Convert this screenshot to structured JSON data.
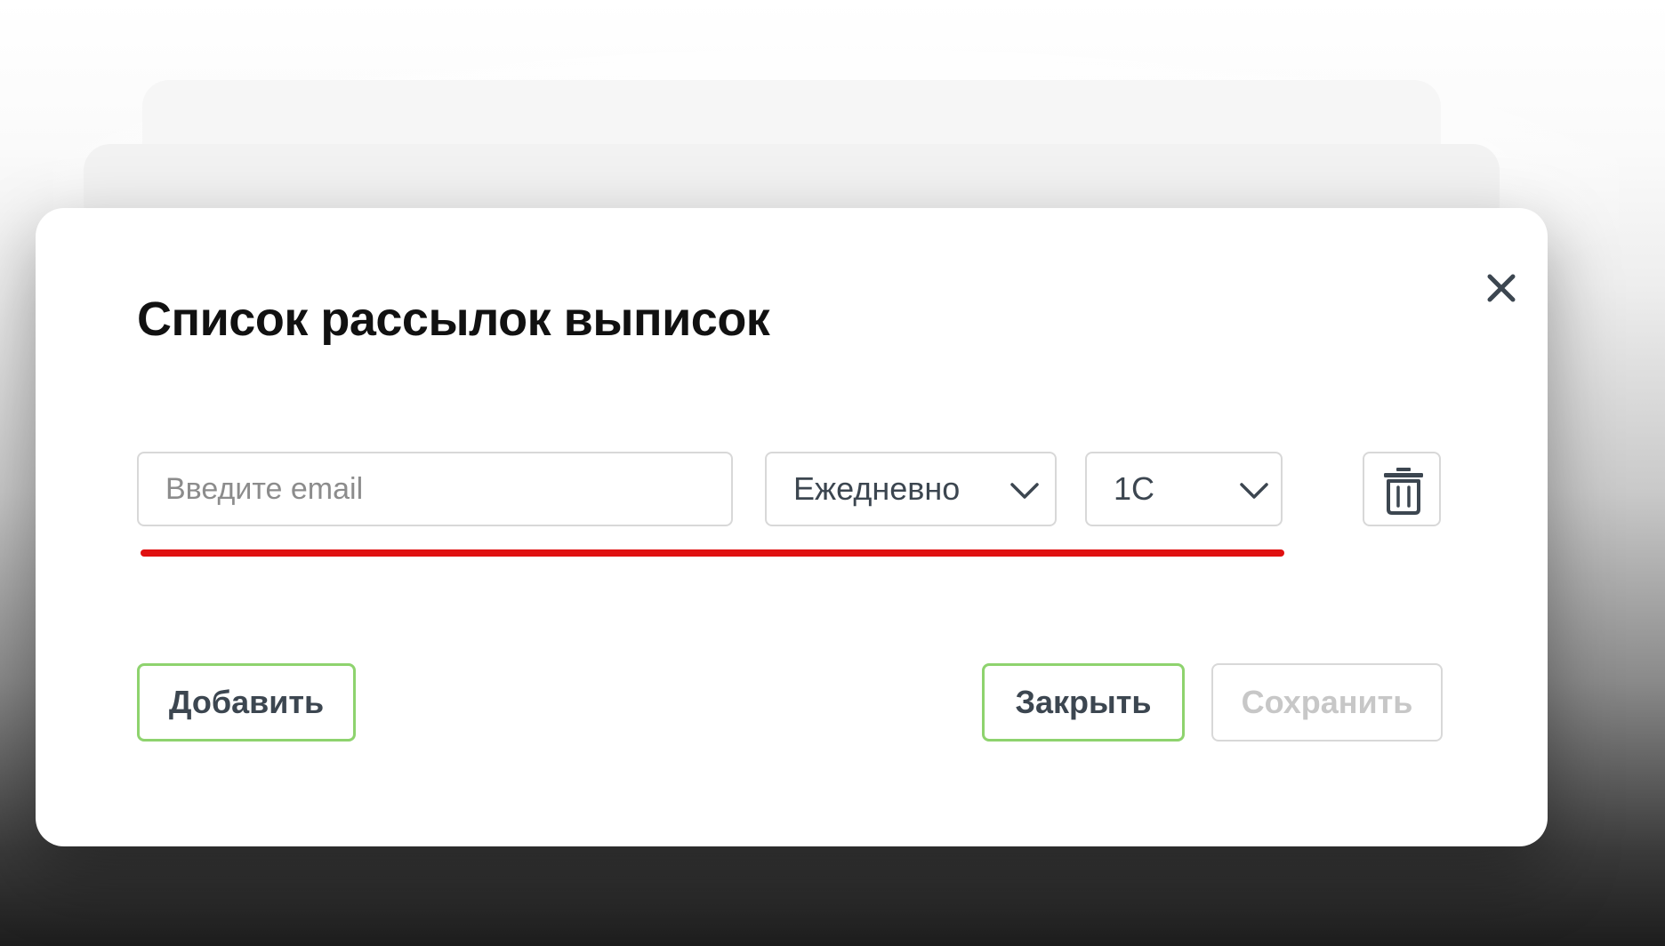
{
  "dialog": {
    "title": "Список рассылок выписок",
    "close_icon": "close-icon"
  },
  "form": {
    "email": {
      "value": "",
      "placeholder": "Введите email"
    },
    "frequency": {
      "selected": "Ежедневно",
      "icon": "chevron-down-icon"
    },
    "format": {
      "selected": "1С",
      "icon": "chevron-down-icon"
    },
    "delete_icon": "trash-icon"
  },
  "actions": {
    "add_label": "Добавить",
    "close_label": "Закрыть",
    "save_label": "Сохранить"
  },
  "colors": {
    "annotation_underline": "#e01010",
    "accent_border": "#8ed36e",
    "text_primary": "#111111",
    "text_secondary": "#3c4650",
    "disabled_text": "#c7c7c7"
  }
}
